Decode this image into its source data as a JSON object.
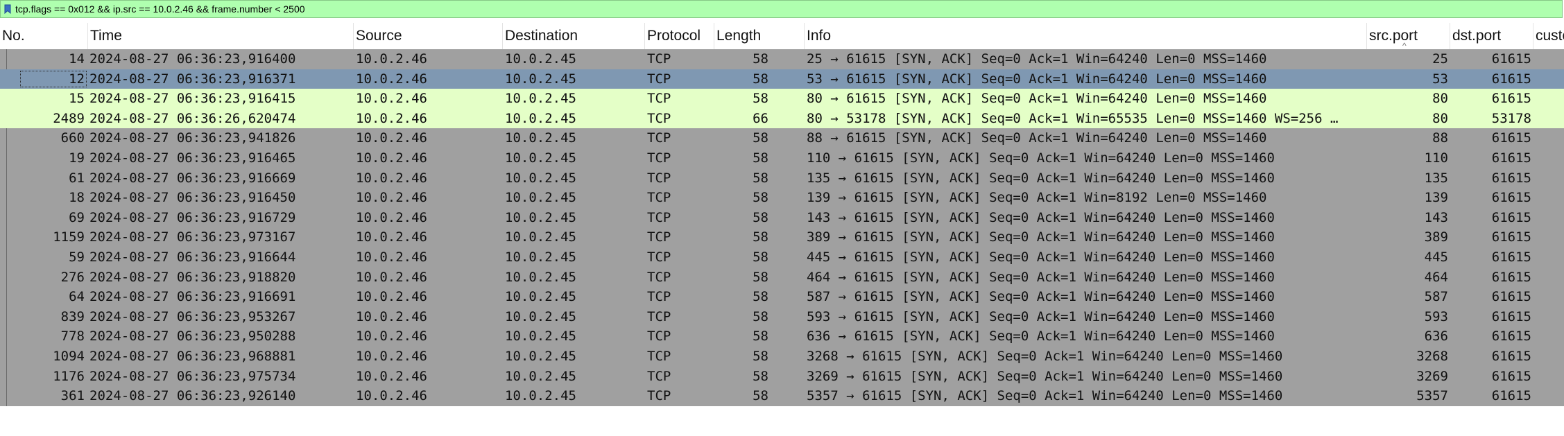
{
  "filter": {
    "text": "tcp.flags == 0x012 && ip.src == 10.0.2.46 && frame.number < 2500"
  },
  "columns": [
    {
      "key": "no",
      "label": "No."
    },
    {
      "key": "time",
      "label": "Time"
    },
    {
      "key": "source",
      "label": "Source"
    },
    {
      "key": "destination",
      "label": "Destination"
    },
    {
      "key": "protocol",
      "label": "Protocol"
    },
    {
      "key": "length",
      "label": "Length"
    },
    {
      "key": "info",
      "label": "Info"
    },
    {
      "key": "srcport",
      "label": "src.port"
    },
    {
      "key": "dstport",
      "label": "dst.port"
    },
    {
      "key": "custom",
      "label": "custo"
    }
  ],
  "sort": {
    "column": "src.port",
    "direction": "ascending"
  },
  "colors": {
    "filter_bg": "#afffaf",
    "row_default": "#a0a0a0",
    "row_green": "#e4ffc7",
    "row_selected": "#7f98b2"
  },
  "rows": [
    {
      "no": "14",
      "time": "2024-08-27 06:36:23,916400",
      "source": "10.0.2.46",
      "destination": "10.0.2.45",
      "protocol": "TCP",
      "length": "58",
      "info": "25 → 61615 [SYN, ACK] Seq=0 Ack=1 Win=64240 Len=0 MSS=1460",
      "srcport": "25",
      "dstport": "61615",
      "style": "default"
    },
    {
      "no": "12",
      "time": "2024-08-27 06:36:23,916371",
      "source": "10.0.2.46",
      "destination": "10.0.2.45",
      "protocol": "TCP",
      "length": "58",
      "info": "53 → 61615 [SYN, ACK] Seq=0 Ack=1 Win=64240 Len=0 MSS=1460",
      "srcport": "53",
      "dstport": "61615",
      "style": "selected"
    },
    {
      "no": "15",
      "time": "2024-08-27 06:36:23,916415",
      "source": "10.0.2.46",
      "destination": "10.0.2.45",
      "protocol": "TCP",
      "length": "58",
      "info": "80 → 61615 [SYN, ACK] Seq=0 Ack=1 Win=64240 Len=0 MSS=1460",
      "srcport": "80",
      "dstport": "61615",
      "style": "green"
    },
    {
      "no": "2489",
      "time": "2024-08-27 06:36:26,620474",
      "source": "10.0.2.46",
      "destination": "10.0.2.45",
      "protocol": "TCP",
      "length": "66",
      "info": "80 → 53178 [SYN, ACK] Seq=0 Ack=1 Win=65535 Len=0 MSS=1460 WS=256 …",
      "srcport": "80",
      "dstport": "53178",
      "style": "green"
    },
    {
      "no": "660",
      "time": "2024-08-27 06:36:23,941826",
      "source": "10.0.2.46",
      "destination": "10.0.2.45",
      "protocol": "TCP",
      "length": "58",
      "info": "88 → 61615 [SYN, ACK] Seq=0 Ack=1 Win=64240 Len=0 MSS=1460",
      "srcport": "88",
      "dstport": "61615",
      "style": "default"
    },
    {
      "no": "19",
      "time": "2024-08-27 06:36:23,916465",
      "source": "10.0.2.46",
      "destination": "10.0.2.45",
      "protocol": "TCP",
      "length": "58",
      "info": "110 → 61615 [SYN, ACK] Seq=0 Ack=1 Win=64240 Len=0 MSS=1460",
      "srcport": "110",
      "dstport": "61615",
      "style": "default"
    },
    {
      "no": "61",
      "time": "2024-08-27 06:36:23,916669",
      "source": "10.0.2.46",
      "destination": "10.0.2.45",
      "protocol": "TCP",
      "length": "58",
      "info": "135 → 61615 [SYN, ACK] Seq=0 Ack=1 Win=64240 Len=0 MSS=1460",
      "srcport": "135",
      "dstport": "61615",
      "style": "default"
    },
    {
      "no": "18",
      "time": "2024-08-27 06:36:23,916450",
      "source": "10.0.2.46",
      "destination": "10.0.2.45",
      "protocol": "TCP",
      "length": "58",
      "info": "139 → 61615 [SYN, ACK] Seq=0 Ack=1 Win=8192 Len=0 MSS=1460",
      "srcport": "139",
      "dstport": "61615",
      "style": "default"
    },
    {
      "no": "69",
      "time": "2024-08-27 06:36:23,916729",
      "source": "10.0.2.46",
      "destination": "10.0.2.45",
      "protocol": "TCP",
      "length": "58",
      "info": "143 → 61615 [SYN, ACK] Seq=0 Ack=1 Win=64240 Len=0 MSS=1460",
      "srcport": "143",
      "dstport": "61615",
      "style": "default"
    },
    {
      "no": "1159",
      "time": "2024-08-27 06:36:23,973167",
      "source": "10.0.2.46",
      "destination": "10.0.2.45",
      "protocol": "TCP",
      "length": "58",
      "info": "389 → 61615 [SYN, ACK] Seq=0 Ack=1 Win=64240 Len=0 MSS=1460",
      "srcport": "389",
      "dstport": "61615",
      "style": "default"
    },
    {
      "no": "59",
      "time": "2024-08-27 06:36:23,916644",
      "source": "10.0.2.46",
      "destination": "10.0.2.45",
      "protocol": "TCP",
      "length": "58",
      "info": "445 → 61615 [SYN, ACK] Seq=0 Ack=1 Win=64240 Len=0 MSS=1460",
      "srcport": "445",
      "dstport": "61615",
      "style": "default"
    },
    {
      "no": "276",
      "time": "2024-08-27 06:36:23,918820",
      "source": "10.0.2.46",
      "destination": "10.0.2.45",
      "protocol": "TCP",
      "length": "58",
      "info": "464 → 61615 [SYN, ACK] Seq=0 Ack=1 Win=64240 Len=0 MSS=1460",
      "srcport": "464",
      "dstport": "61615",
      "style": "default"
    },
    {
      "no": "64",
      "time": "2024-08-27 06:36:23,916691",
      "source": "10.0.2.46",
      "destination": "10.0.2.45",
      "protocol": "TCP",
      "length": "58",
      "info": "587 → 61615 [SYN, ACK] Seq=0 Ack=1 Win=64240 Len=0 MSS=1460",
      "srcport": "587",
      "dstport": "61615",
      "style": "default"
    },
    {
      "no": "839",
      "time": "2024-08-27 06:36:23,953267",
      "source": "10.0.2.46",
      "destination": "10.0.2.45",
      "protocol": "TCP",
      "length": "58",
      "info": "593 → 61615 [SYN, ACK] Seq=0 Ack=1 Win=64240 Len=0 MSS=1460",
      "srcport": "593",
      "dstport": "61615",
      "style": "default"
    },
    {
      "no": "778",
      "time": "2024-08-27 06:36:23,950288",
      "source": "10.0.2.46",
      "destination": "10.0.2.45",
      "protocol": "TCP",
      "length": "58",
      "info": "636 → 61615 [SYN, ACK] Seq=0 Ack=1 Win=64240 Len=0 MSS=1460",
      "srcport": "636",
      "dstport": "61615",
      "style": "default"
    },
    {
      "no": "1094",
      "time": "2024-08-27 06:36:23,968881",
      "source": "10.0.2.46",
      "destination": "10.0.2.45",
      "protocol": "TCP",
      "length": "58",
      "info": "3268 → 61615 [SYN, ACK] Seq=0 Ack=1 Win=64240 Len=0 MSS=1460",
      "srcport": "3268",
      "dstport": "61615",
      "style": "default"
    },
    {
      "no": "1176",
      "time": "2024-08-27 06:36:23,975734",
      "source": "10.0.2.46",
      "destination": "10.0.2.45",
      "protocol": "TCP",
      "length": "58",
      "info": "3269 → 61615 [SYN, ACK] Seq=0 Ack=1 Win=64240 Len=0 MSS=1460",
      "srcport": "3269",
      "dstport": "61615",
      "style": "default"
    },
    {
      "no": "361",
      "time": "2024-08-27 06:36:23,926140",
      "source": "10.0.2.46",
      "destination": "10.0.2.45",
      "protocol": "TCP",
      "length": "58",
      "info": "5357 → 61615 [SYN, ACK] Seq=0 Ack=1 Win=64240 Len=0 MSS=1460",
      "srcport": "5357",
      "dstport": "61615",
      "style": "default"
    }
  ]
}
